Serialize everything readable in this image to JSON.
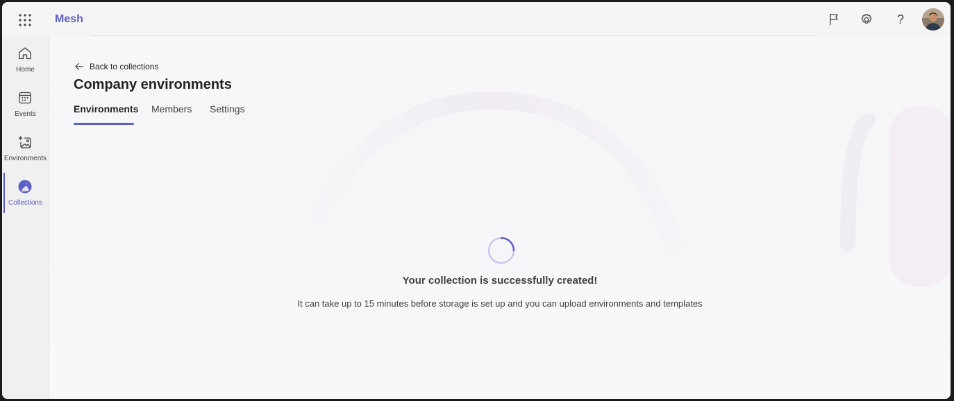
{
  "app": {
    "name": "Mesh"
  },
  "topbar": {
    "icons": [
      "app-launcher-icon",
      "flag-icon",
      "gear-icon",
      "help-icon"
    ],
    "help_glyph": "?"
  },
  "rail": {
    "items": [
      {
        "label": "Home",
        "icon": "home-icon"
      },
      {
        "label": "Events",
        "icon": "calendar-icon"
      },
      {
        "label": "Environments",
        "icon": "image-sparkle-icon"
      },
      {
        "label": "Collections",
        "icon": "collections-icon",
        "active": true
      }
    ]
  },
  "page": {
    "back_label": "Back to collections",
    "title": "Company environments",
    "tabs": [
      {
        "label": "Environments",
        "active": true
      },
      {
        "label": "Members"
      },
      {
        "label": "Settings"
      }
    ]
  },
  "status": {
    "title": "Your collection is successfully created!",
    "subtitle": "It can take up to 15 minutes before storage is set up and you can upload environments and templates"
  },
  "colors": {
    "accent": "#5b5fc7",
    "background": "#f5f5f5",
    "text": "#242424"
  }
}
